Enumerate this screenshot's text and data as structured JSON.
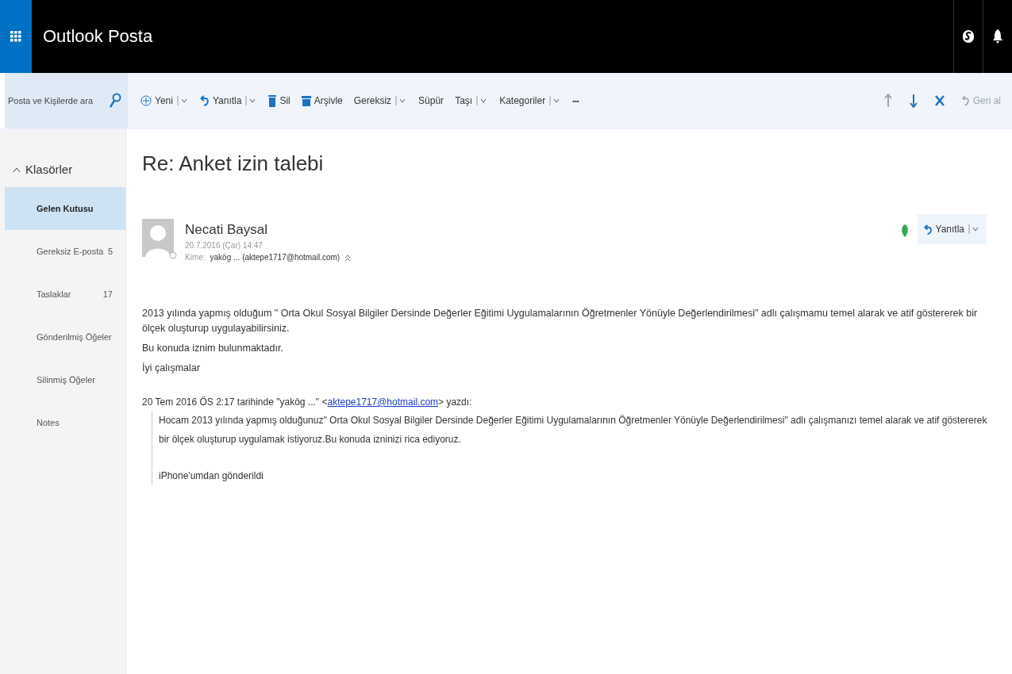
{
  "app_title": "Outlook Posta",
  "search": {
    "placeholder": "Posta ve Kişilerde ara"
  },
  "toolbar": [
    {
      "kind": "plus",
      "label": "Yeni",
      "dropdown": true
    },
    {
      "kind": "reply",
      "label": "Yanıtla",
      "dropdown": true
    },
    {
      "kind": "trash",
      "label": "Sil",
      "dropdown": false
    },
    {
      "kind": "archive",
      "label": "Arşivle",
      "dropdown": false
    },
    {
      "kind": "text",
      "label": "Gereksiz",
      "dropdown": true
    },
    {
      "kind": "text",
      "label": "Süpür",
      "dropdown": false
    },
    {
      "kind": "text",
      "label": "Taşı",
      "dropdown": true
    },
    {
      "kind": "text",
      "label": "Kategoriler",
      "dropdown": true
    },
    {
      "kind": "more",
      "label": "•••",
      "dropdown": false
    }
  ],
  "nav": [
    {
      "kind": "up",
      "disabled": true
    },
    {
      "kind": "down",
      "disabled": false
    },
    {
      "kind": "close",
      "disabled": false
    }
  ],
  "undo": {
    "label": "Geri al",
    "disabled": true
  },
  "folders": {
    "label": "Klasörler",
    "expanded": true,
    "items": [
      {
        "name": "Gelen Kutusu",
        "selected": true
      },
      {
        "name": "Gereksiz E-posta",
        "count": "5",
        "selected": false
      },
      {
        "name": "Taslaklar",
        "count": "17",
        "selected": false
      },
      {
        "name": "Gönderilmiş Öğeler",
        "selected": false
      },
      {
        "name": "Silinmiş Öğeler",
        "selected": false
      },
      {
        "name": "Notes",
        "selected": false
      }
    ]
  },
  "message": {
    "subject": "Re: Anket izin talebi",
    "sender": "Necati Baysal",
    "date": "20.7.2016 (Çar) 14:47",
    "to_label": "Kime:",
    "to": "yakög ... (aktepe1717@hotmail.com)",
    "reply_button": "Yanıtla",
    "body": [
      "2013 yılında yapmış olduğum \" Orta Okul Sosyal Bilgiler Dersinde Değerler Eğitimi Uygulamalarının Öğretmenler Yönüyle Değerlendirilmesi\" adlı çalışmamu temel alarak ve atif göstererek bir ölçek oluşturup uygulayabilirsiniz.",
      "Bu konuda iznim bulunmaktadır.",
      "İyi çalışmalar"
    ],
    "quote_header": {
      "before": "20 Tem 2016 ÖS 2:17 tarihinde \"yakög ...\" <",
      "link": "aktepe1717@hotmail.com",
      "after": "> yazdı:"
    },
    "quote": [
      "Hocam 2013 yılında yapmış olduğunuz\" Orta Okul Sosyal Bilgiler Dersinde Değerler Eğitimi Uygulamalarının Öğretmenler Yönüyle Değerlendirilmesi\" adlı çalışmanızı temel alarak ve atif göstererek bir ölçek oluşturup uygulamak istiyoruz.Bu konuda izninizi rica ediyoruz.",
      "iPhone'umdan gönderildi"
    ]
  }
}
